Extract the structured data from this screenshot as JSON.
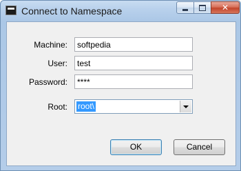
{
  "window": {
    "title": "Connect to Namespace",
    "icon": "app-icon"
  },
  "titlebar": {
    "minimize_icon": "minimize-icon",
    "maximize_icon": "maximize-icon",
    "close_glyph": "✕"
  },
  "form": {
    "machine_label": "Machine:",
    "machine_value": "softpedia",
    "user_label": "User:",
    "user_value": "test",
    "password_label": "Password:",
    "password_value": "****",
    "root_label": "Root:",
    "root_value": "root\\"
  },
  "buttons": {
    "ok_label": "OK",
    "cancel_label": "Cancel"
  },
  "colors": {
    "accent": "#3399ff",
    "titlebar": "#b9d1ec",
    "close": "#c2452b"
  }
}
